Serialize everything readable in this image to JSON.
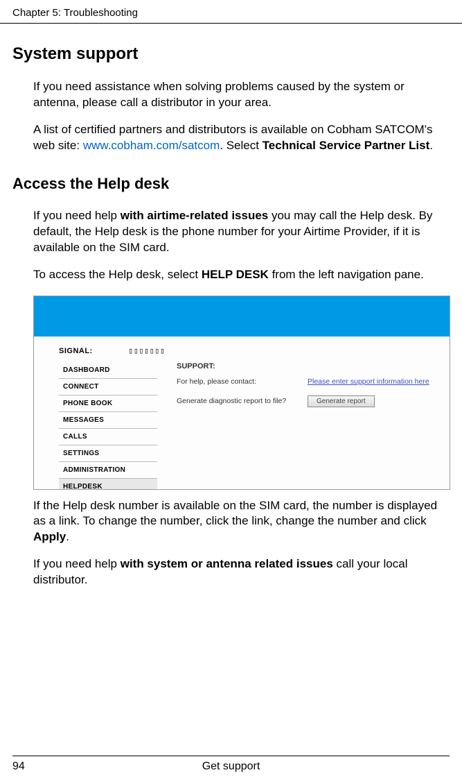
{
  "header": {
    "chapter": "Chapter 5:  Troubleshooting"
  },
  "h1": "System support",
  "para1": "If you need assistance when solving problems caused by the system or antenna, please call a distributor in your area.",
  "para2_a": "A list of certified partners and distributors is available on Cobham SATCOM's web site: ",
  "para2_link": "www.cobham.com/satcom",
  "para2_b": ". Select ",
  "para2_bold": "Technical Service Partner List",
  "para2_c": ".",
  "h2": "Access the Help desk",
  "para3_a": "If you need help ",
  "para3_bold": "with airtime-related issues",
  "para3_b": " you may call the Help desk. By default, the Help desk is the phone number for your Airtime Provider, if it is available on the SIM card.",
  "para4_a": "To access the Help desk, select ",
  "para4_bold": "HELP DESK",
  "para4_b": " from the left navigation pane.",
  "fig": {
    "signal_label": "SIGNAL:",
    "signal_bars": "▯▯▯▯▯▯▯",
    "nav": [
      "DASHBOARD",
      "CONNECT",
      "PHONE BOOK",
      "MESSAGES",
      "CALLS",
      "SETTINGS",
      "ADMINISTRATION",
      "HELPDESK"
    ],
    "support_heading": "SUPPORT:",
    "row1_label": "For help, please contact:",
    "row1_link": "Please enter support information here",
    "row2_label": "Generate diagnostic report to file?",
    "row2_button": "Generate report"
  },
  "para5_a": "If the Help desk number is available on the SIM card, the number is displayed as a link. To change the number, click the link, change the number and click ",
  "para5_bold": "Apply",
  "para5_b": ".",
  "para6_a": "If you need help ",
  "para6_bold": "with system or antenna related issues",
  "para6_b": " call your local distributor.",
  "footer": {
    "page": "94",
    "title": "Get support"
  }
}
